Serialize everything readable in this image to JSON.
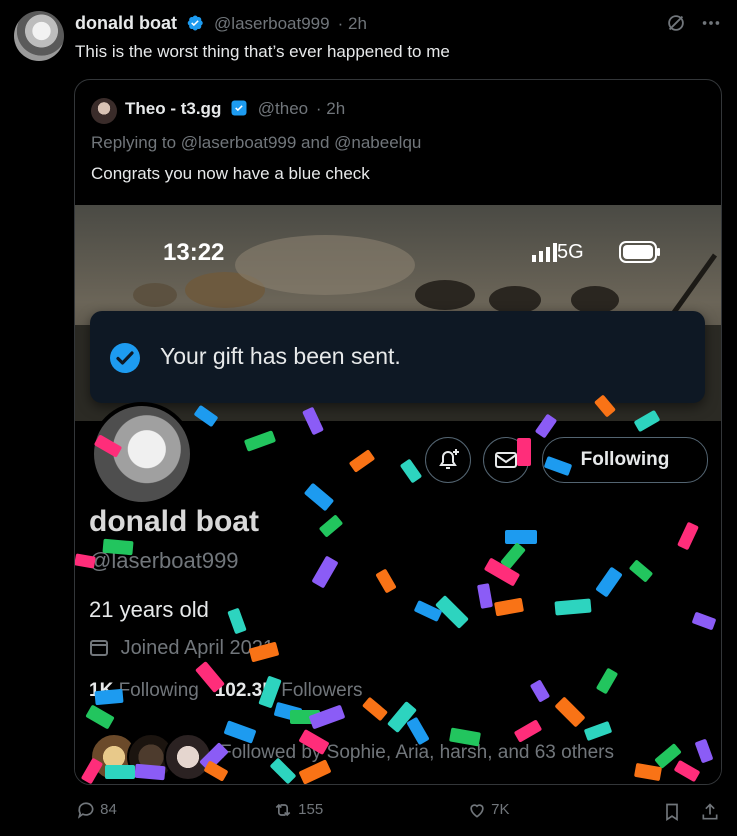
{
  "tweet": {
    "author_name": "donald boat",
    "author_handle": "@laserboat999",
    "time": "· 2h",
    "text": "This is the worst thing that’s ever happened to me"
  },
  "quote": {
    "author_name": "Theo - t3.gg",
    "author_handle": "@theo",
    "time": "· 2h",
    "replying": "Replying to @laserboat999 and @nabeelqu",
    "text": "Congrats you now have a blue check"
  },
  "screenshot": {
    "time": "13:22",
    "network": "5G",
    "toast": "Your gift has been sent.",
    "follow_button": "Following",
    "profile_name": "donald boat",
    "profile_handle": "@laserboat999",
    "age": "21 years old",
    "joined": "Joined April 2021",
    "following_count": "1K",
    "following_label": "Following",
    "followers_count": "102.3K",
    "followers_label": "Followers",
    "followed_by": "Followed by Sophie, Aria, harsh, and 63 others"
  },
  "actions": {
    "replies": "84",
    "reposts": "155",
    "likes": "7K"
  },
  "colors": {
    "verified": "#1d9bf0",
    "confetti": [
      "#1d9bf0",
      "#22c55e",
      "#ff2d7a",
      "#8b5cf6",
      "#f97316",
      "#2dd4bf"
    ]
  }
}
